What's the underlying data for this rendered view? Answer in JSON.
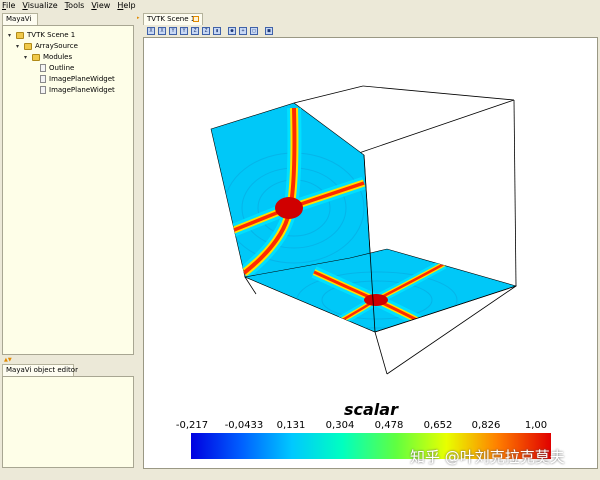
{
  "menubar": [
    "File",
    "Visualize",
    "Tools",
    "View",
    "Help"
  ],
  "left_panel": {
    "tab": "MayaVi",
    "tree": [
      {
        "label": "TVTK Scene 1",
        "level": 0,
        "icon": "folder-icon",
        "expanded": true
      },
      {
        "label": "ArraySource",
        "level": 1,
        "icon": "folder-icon",
        "expanded": true
      },
      {
        "label": "Modules",
        "level": 2,
        "icon": "folder-icon",
        "expanded": true
      },
      {
        "label": "Outline",
        "level": 3,
        "icon": "document-icon"
      },
      {
        "label": "ImagePlaneWidget",
        "level": 3,
        "icon": "document-icon"
      },
      {
        "label": "ImagePlaneWidget",
        "level": 3,
        "icon": "document-icon"
      }
    ]
  },
  "editor_panel": {
    "tab": "MayaVi object editor"
  },
  "scene": {
    "tab": "TVTK Scene 1",
    "toolbar": [
      {
        "name": "view-x-icon",
        "glyph": "X"
      },
      {
        "name": "view-neg-x-icon",
        "glyph": "X"
      },
      {
        "name": "view-y-icon",
        "glyph": "Y"
      },
      {
        "name": "view-neg-y-icon",
        "glyph": "Y"
      },
      {
        "name": "view-z-icon",
        "glyph": "Z"
      },
      {
        "name": "view-neg-z-icon",
        "glyph": "Z"
      },
      {
        "name": "isometric-icon",
        "glyph": "▮"
      },
      {
        "name": "parallel-projection-icon",
        "glyph": "●"
      },
      {
        "name": "axes-icon",
        "glyph": "+"
      },
      {
        "name": "fullscreen-icon",
        "glyph": "□"
      },
      {
        "name": "save-icon",
        "glyph": "■"
      }
    ]
  },
  "colorbar": {
    "title": "scalar",
    "labels": [
      "-0,217",
      "-0,0433",
      "0,131",
      "0,304",
      "0,478",
      "0,652",
      "0,826",
      "1,00"
    ]
  },
  "watermark": "知乎 @叶刘克拉克莫夫"
}
